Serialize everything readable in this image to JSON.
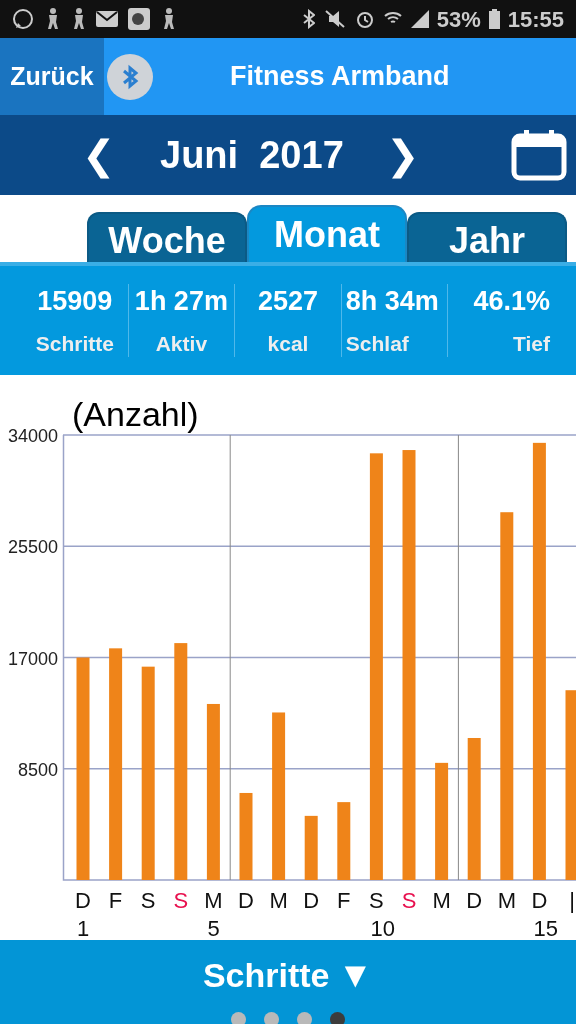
{
  "status_bar": {
    "battery": "53%",
    "time": "15:55"
  },
  "header": {
    "back": "Zurück",
    "title": "Fitness Armband"
  },
  "month_nav": {
    "label": "Juni  2017",
    "prev": "❮",
    "next": "❯"
  },
  "tabs": [
    {
      "label": "Woche",
      "selected": false
    },
    {
      "label": "Monat",
      "selected": true
    },
    {
      "label": "Jahr",
      "selected": false
    }
  ],
  "stats": [
    {
      "value": "15909",
      "label": "Schritte"
    },
    {
      "value": "1h 27m",
      "label": "Aktiv"
    },
    {
      "value": "2527",
      "label": "kcal"
    },
    {
      "value": "8h 34m",
      "label": "Schlaf"
    },
    {
      "value": "46.1%",
      "label": "Tief"
    }
  ],
  "chart": {
    "unit": "(Anzahl)",
    "days": [
      {
        "number": "1",
        "sunday": false
      },
      {
        "sunday": false
      },
      {
        "sunday": false
      },
      {
        "sunday": true
      },
      {
        "number": "5",
        "sunday": false
      },
      {
        "sunday": false
      },
      {
        "sunday": false
      },
      {
        "sunday": false
      },
      {
        "sunday": false
      },
      {
        "number": "10",
        "sunday": false
      },
      {
        "sunday": true
      },
      {
        "sunday": false
      },
      {
        "sunday": false
      },
      {
        "sunday": false
      },
      {
        "number": "15",
        "sunday": false
      },
      {
        "sunday": false
      }
    ],
    "chart_data": {
      "type": "bar",
      "categories": [
        "D",
        "F",
        "S",
        "S",
        "M",
        "D",
        "M",
        "D",
        "F",
        "S",
        "S",
        "M",
        "D",
        "M",
        "D",
        "|"
      ],
      "values": [
        17000,
        17700,
        16300,
        18100,
        13450,
        6650,
        12800,
        4900,
        5950,
        32600,
        32850,
        8950,
        10850,
        28100,
        33400,
        14500
      ],
      "ylim": [
        0,
        34000
      ],
      "yticks": [
        8500,
        17000,
        25500,
        34000
      ],
      "grid": true
    }
  },
  "footer": {
    "selector": "Schritte",
    "selector_arrow": "▼",
    "pages": [
      {
        "selected": false
      },
      {
        "selected": false
      },
      {
        "selected": false
      },
      {
        "selected": true
      }
    ]
  }
}
